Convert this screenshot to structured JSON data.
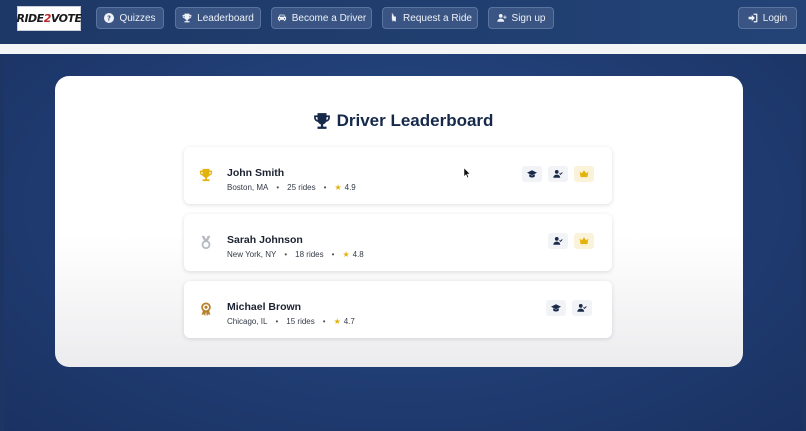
{
  "brand": {
    "logo_left": "RIDE",
    "logo_accent": "2",
    "logo_right": "VOTE"
  },
  "nav": {
    "items": [
      {
        "label": "Quizzes",
        "icon": "question-circle-icon"
      },
      {
        "label": "Leaderboard",
        "icon": "trophy-icon"
      },
      {
        "label": "Become a Driver",
        "icon": "car-icon"
      },
      {
        "label": "Request a Ride",
        "icon": "ticket-icon"
      },
      {
        "label": "Sign up",
        "icon": "user-plus-icon"
      }
    ],
    "login": {
      "label": "Login",
      "icon": "sign-in-icon"
    }
  },
  "page": {
    "title": "Driver Leaderboard",
    "title_icon": "trophy-icon"
  },
  "leaderboard": [
    {
      "rank_medal": "gold-trophy",
      "name": "John Smith",
      "location": "Boston, MA",
      "rides": "25 rides",
      "rating": "4.9",
      "badges": [
        "graduation-cap-icon",
        "user-check-icon",
        "crown-icon"
      ]
    },
    {
      "rank_medal": "silver-medal",
      "name": "Sarah Johnson",
      "location": "New York, NY",
      "rides": "18 rides",
      "rating": "4.8",
      "badges": [
        "user-check-icon",
        "crown-icon"
      ]
    },
    {
      "rank_medal": "bronze-award",
      "name": "Michael Brown",
      "location": "Chicago, IL",
      "rides": "15 rides",
      "rating": "4.7",
      "badges": [
        "graduation-cap-icon",
        "user-check-icon"
      ]
    }
  ],
  "colors": {
    "nav_bg": "#1d3866",
    "nav_button": "#3a5583",
    "title_text": "#16294a",
    "gold": "#e3b20c",
    "silver": "#b5b9c0",
    "bronze": "#b7822e"
  },
  "separator": "•",
  "star_glyph": "★"
}
